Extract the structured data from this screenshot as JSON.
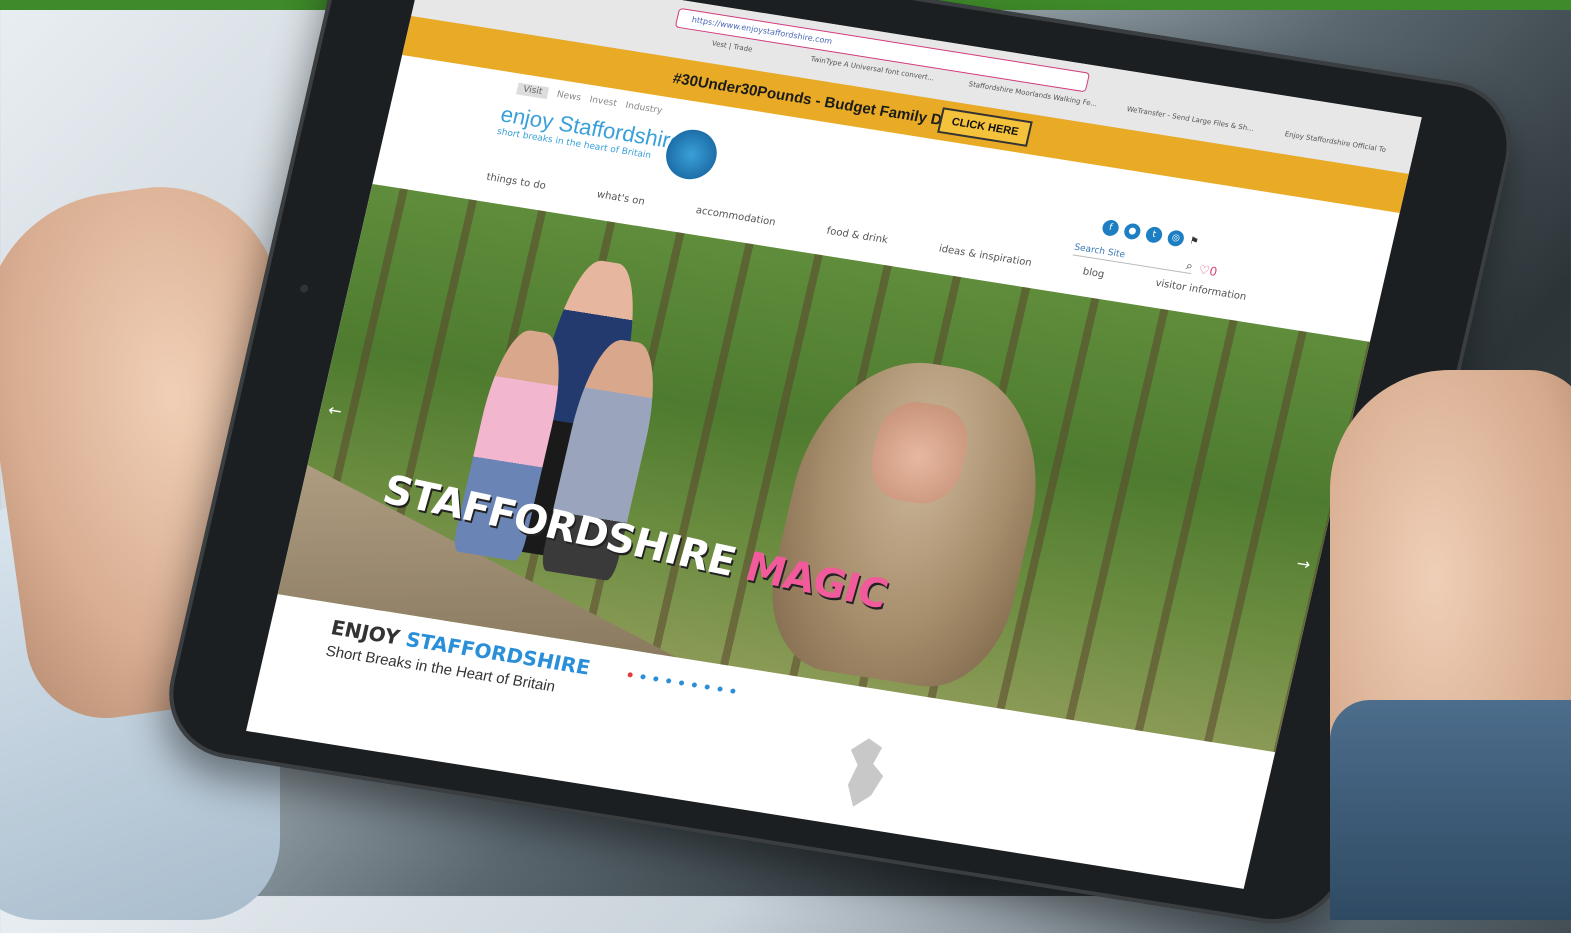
{
  "page": {
    "side_fragment": "on",
    "accent_green": "#3f8a2a"
  },
  "browser": {
    "url": "https://www.enjoystaffordshire.com",
    "tab_label": "Enjoy Staffordshire Official To",
    "bookmarks": [
      "Vest | Trade",
      "TwinType A Universal font convert...",
      "Staffordshire Moorlands Walking Fe...",
      "WeTransfer - Send Large Files & Sh..."
    ]
  },
  "banner": {
    "text": "#30Under30Pounds - Budget Family Days Out",
    "button": "CLICK HERE",
    "color": "#e9ab25"
  },
  "subnav": {
    "items": [
      "Visit",
      "News",
      "Invest",
      "Industry"
    ]
  },
  "logo": {
    "name": "enjoy Staffordshire",
    "tagline": "short breaks in the heart of Britain"
  },
  "header": {
    "search_placeholder": "Search Site",
    "social_icons": [
      "facebook-icon",
      "messenger-icon",
      "twitter-icon",
      "instagram-icon"
    ],
    "favourites_count": "0"
  },
  "nav": {
    "items": [
      "things to do",
      "what's on",
      "accommodation",
      "food & drink",
      "ideas & inspiration",
      "blog",
      "visitor information"
    ]
  },
  "hero": {
    "title_main": "STAFFORDSHIRE",
    "title_accent": "MAGIC",
    "carousel_total": 9,
    "carousel_active": 0
  },
  "brand": {
    "enjoy": "ENJOY",
    "staffordshire": "STAFFORDSHIRE",
    "tagline": "Short Breaks in the Heart of Britain"
  }
}
